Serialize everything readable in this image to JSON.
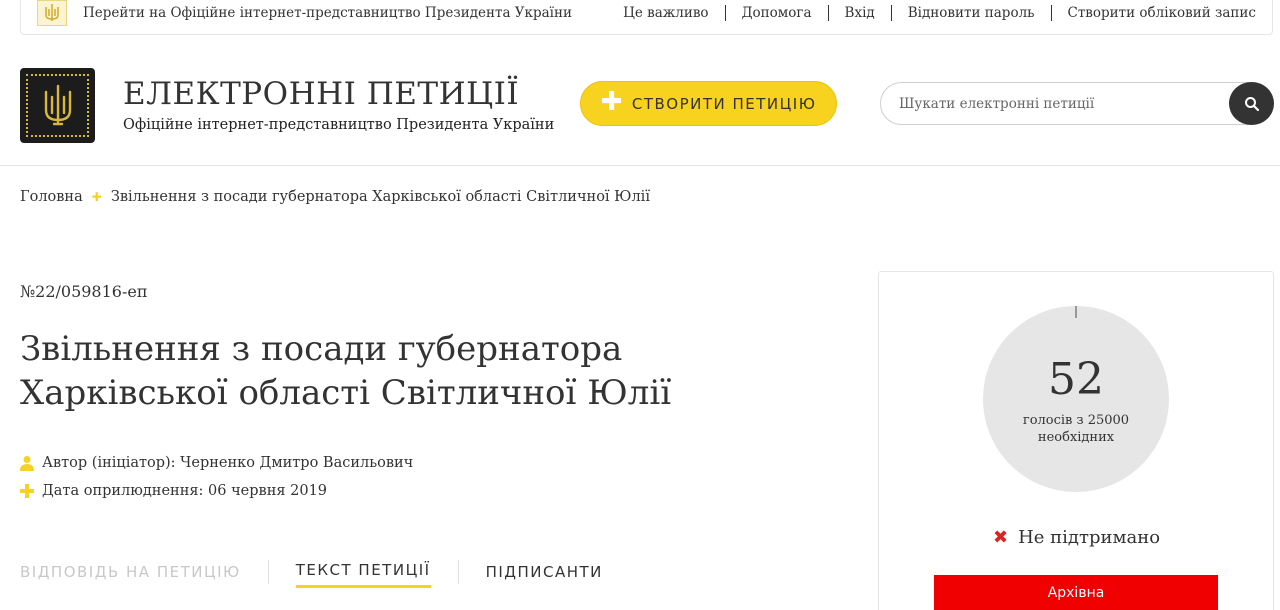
{
  "topbar": {
    "president_link": "Перейти на Офіційне інтернет-представництво Президента України",
    "nav": [
      "Це важливо",
      "Допомога",
      "Вхід",
      "Відновити пароль",
      "Створити обліковий запис"
    ]
  },
  "header": {
    "title": "ЕЛЕКТРОННІ ПЕТИЦІЇ",
    "subtitle": "Офіційне інтернет-представництво Президента України",
    "create_button": "СТВОРИТИ ПЕТИЦІЮ",
    "search_placeholder": "Шукати електронні петиції"
  },
  "breadcrumb": {
    "home": "Головна",
    "current": "Звільнення з посади губернатора Харківської області Світличної Юлії"
  },
  "petition": {
    "number": "№22/059816-еп",
    "title": "Звільнення з посади губернатора Харківської області Світличної Юлії",
    "author": "Автор (ініціатор): Черненко Дмитро Васильович",
    "date": "Дата оприлюднення: 06 червня 2019"
  },
  "tabs": {
    "answer": "ВІДПОВІДЬ НА ПЕТИЦІЮ",
    "text": "ТЕКСТ ПЕТИЦІЇ",
    "signers": "ПІДПИСАНТИ"
  },
  "votes": {
    "count": "52",
    "label_line1": "голосів з 25000",
    "label_line2": "необхідних",
    "status": "Не підтримано",
    "badge": "Архівна"
  },
  "colors": {
    "accent_yellow": "#f7d21e",
    "dark": "#333333",
    "archive_red": "#f00000",
    "status_x_red": "#dd2222"
  }
}
